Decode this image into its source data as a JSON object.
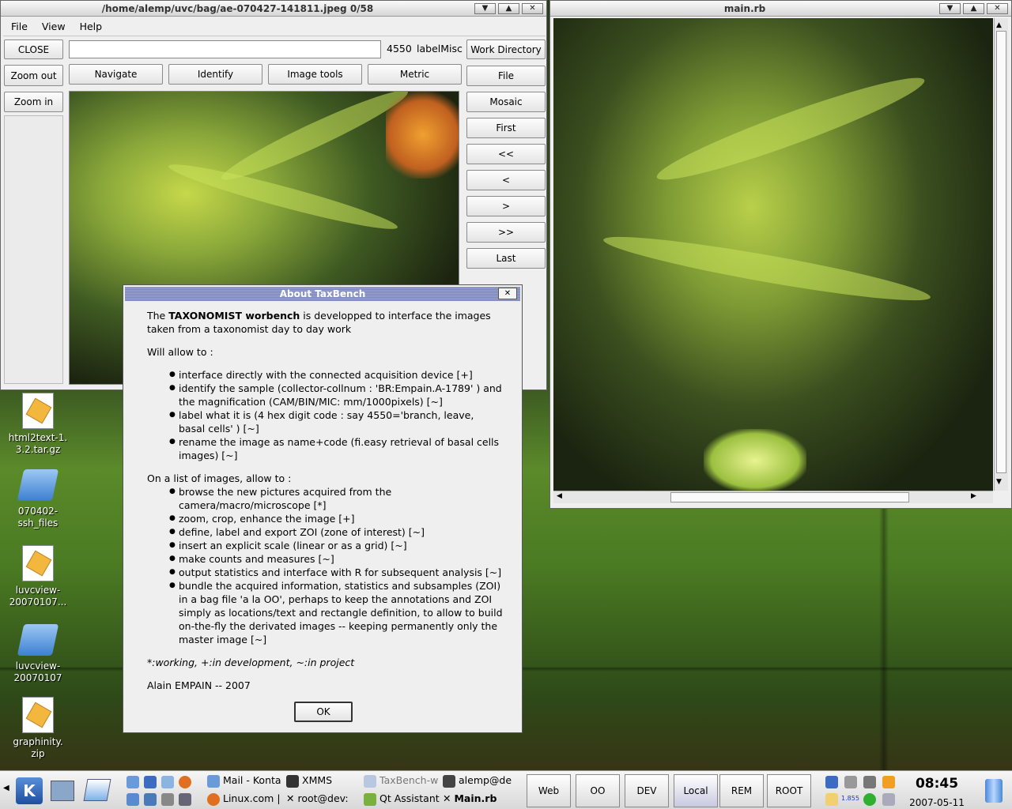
{
  "main_window": {
    "title": "/home/alemp/uvc/bag/ae-070427-141811.jpeg 0/58",
    "menu": [
      "File",
      "View",
      "Help"
    ],
    "close_label": "CLOSE",
    "zoom_out_label": "Zoom out",
    "zoom_in_label": "Zoom in",
    "label_code": "4550",
    "label_misc": "labelMisc",
    "work_dir_label": "Work Directory",
    "tabs": [
      "Navigate",
      "Identify",
      "Image tools",
      "Metric"
    ],
    "side_buttons": [
      "File",
      "Mosaic",
      "First",
      "<<",
      "<",
      ">",
      ">>",
      "Last"
    ],
    "input_value": ""
  },
  "viewer_window": {
    "title": "main.rb"
  },
  "about_dialog": {
    "title": "About TaxBench",
    "intro_pre": "The ",
    "intro_bold": "TAXONOMIST worbench",
    "intro_post": " is developped to interface the images taken from a taxonomist day to day work",
    "will_allow": "Will allow to :",
    "allow_items": [
      "interface directly with the connected acquisition device [+]",
      "identify the sample (collector-collnum : 'BR:Empain.A-1789' ) and the magnification (CAM/BIN/MIC: mm/1000pixels) [~]",
      "label what it is (4 hex digit code : say 4550='branch, leave, basal cells' ) [~]",
      "rename the image as name+code (fi.easy retrieval of basal cells images) [~]"
    ],
    "list_intro": "On a list of images, allow to :",
    "list_items": [
      "browse the new pictures acquired from the camera/macro/microscope [*]",
      "zoom, crop, enhance the image [+]",
      "define, label and export ZOI (zone of interest) [~]",
      "insert an explicit scale (linear or as a grid) [~]",
      "make counts and measures [~]",
      "output statistics and interface with R for subsequent analysis [~]",
      "bundle the acquired information, statistics and subsamples (ZOI) in a bag file 'a la OO', perhaps to keep the annotations and ZOI simply as locations/text and rectangle definition, to allow to build on-the-fly the derivated images -- keeping permanently only the master image [~]"
    ],
    "legend": "*:working, +:in development, ~:in project",
    "author": "Alain EMPAIN -- 2007",
    "ok_label": "OK"
  },
  "desktop_icons": [
    {
      "label": "html2text-1.\n3.2.tar.gz",
      "icon": "archive-icon"
    },
    {
      "label": "070402-\nssh_files",
      "icon": "folder-icon"
    },
    {
      "label": "luvcview-\n20070107...",
      "icon": "archive-icon"
    },
    {
      "label": "luvcview-\n20070107",
      "icon": "folder-icon"
    },
    {
      "label": "graphinity.\nzip",
      "icon": "archive-icon"
    }
  ],
  "taskbar": {
    "tasks_top": [
      "Mail - Konta",
      "XMMS",
      "TaxBench-w",
      "alemp@de"
    ],
    "tasks_bottom": [
      "Linux.com |",
      "root@dev:",
      "Qt Assistant",
      "Main.rb"
    ],
    "desktops": [
      "Web",
      "OO",
      "DEV",
      "Local",
      "REM",
      "ROOT"
    ],
    "time": "08:45",
    "date": "2007-05-11",
    "tray_count": "1.855"
  },
  "colors": {
    "dialog_title": "#8790c2",
    "window_bg": "#efefef"
  }
}
